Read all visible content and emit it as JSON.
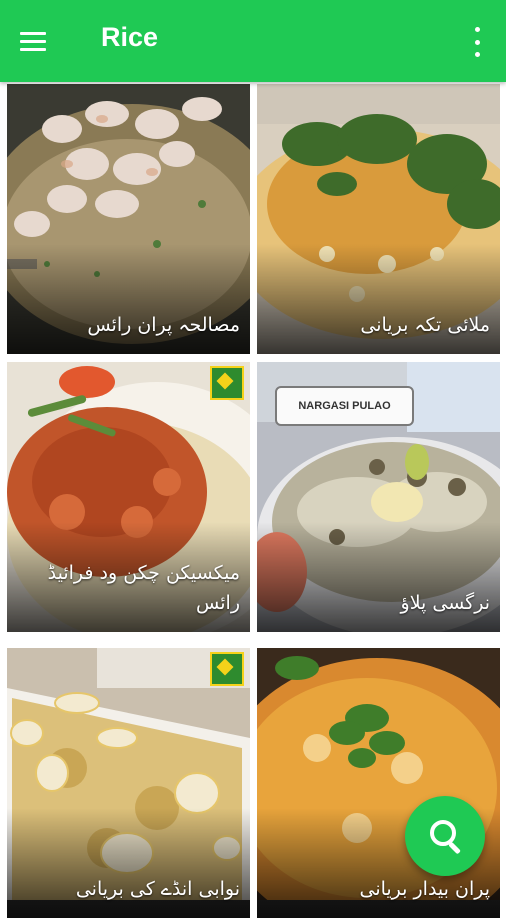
{
  "app_bar": {
    "title": "Rice",
    "menu_icon": "menu-icon",
    "more_icon": "more-vert-icon",
    "color": "#1fc954"
  },
  "recipes": [
    {
      "title": "مصالحہ پران رائس"
    },
    {
      "title": "ملائی تکہ بریانی"
    },
    {
      "title": "میکسیکن چکن ود فرائیڈ رائس"
    },
    {
      "title": "نرگسی پلاؤ",
      "sign_text": "NARGASI PULAO"
    },
    {
      "title": "نوابی انڈے کی بریانی"
    },
    {
      "title": "پران بیدار بریانی"
    }
  ],
  "fab": {
    "icon": "search-icon"
  }
}
